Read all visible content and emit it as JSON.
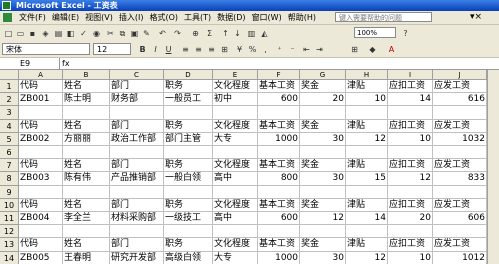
{
  "window": {
    "title": "Microsoft Excel - 工资表"
  },
  "menu": {
    "items": [
      "文件(F)",
      "编辑(E)",
      "视图(V)",
      "插入(I)",
      "格式(O)",
      "工具(T)",
      "数据(D)",
      "窗口(W)",
      "帮助(H)"
    ],
    "help_placeholder": "键入需要帮助的问题"
  },
  "toolbar": {
    "zoom": "100%",
    "font_name": "宋体",
    "font_size": "12"
  },
  "formula_bar": {
    "name_box": "E9",
    "fx": "fx",
    "value": ""
  },
  "sheet": {
    "columns": [
      "A",
      "B",
      "C",
      "D",
      "E",
      "F",
      "G",
      "H",
      "I",
      "J"
    ],
    "rows": [
      {
        "num": "1",
        "cells": [
          "代码",
          "姓名",
          "部门",
          "职务",
          "文化程度",
          "基本工资",
          "奖金",
          "津贴",
          "应扣工资",
          "应发工资"
        ]
      },
      {
        "num": "2",
        "cells": [
          "ZB001",
          "陈士明",
          "财务部",
          "一般员工",
          "初中",
          "600",
          "20",
          "10",
          "14",
          "616"
        ]
      },
      {
        "num": "3",
        "cells": [
          "",
          "",
          "",
          "",
          "",
          "",
          "",
          "",
          "",
          ""
        ]
      },
      {
        "num": "4",
        "cells": [
          "代码",
          "姓名",
          "部门",
          "职务",
          "文化程度",
          "基本工资",
          "奖金",
          "津贴",
          "应扣工资",
          "应发工资"
        ]
      },
      {
        "num": "5",
        "cells": [
          "ZB002",
          "方丽丽",
          "政治工作部",
          "部门主管",
          "大专",
          "1000",
          "30",
          "12",
          "10",
          "1032"
        ]
      },
      {
        "num": "6",
        "cells": [
          "",
          "",
          "",
          "",
          "",
          "",
          "",
          "",
          "",
          ""
        ]
      },
      {
        "num": "7",
        "cells": [
          "代码",
          "姓名",
          "部门",
          "职务",
          "文化程度",
          "基本工资",
          "奖金",
          "津贴",
          "应扣工资",
          "应发工资"
        ]
      },
      {
        "num": "8",
        "cells": [
          "ZB003",
          "陈有伟",
          "产品推销部",
          "一般白领",
          "高中",
          "800",
          "30",
          "15",
          "12",
          "833"
        ]
      },
      {
        "num": "9",
        "cells": [
          "",
          "",
          "",
          "",
          "",
          "",
          "",
          "",
          "",
          ""
        ]
      },
      {
        "num": "10",
        "cells": [
          "代码",
          "姓名",
          "部门",
          "职务",
          "文化程度",
          "基本工资",
          "奖金",
          "津贴",
          "应扣工资",
          "应发工资"
        ]
      },
      {
        "num": "11",
        "cells": [
          "ZB004",
          "李全兰",
          "材料采购部",
          "一级技工",
          "高中",
          "600",
          "12",
          "14",
          "20",
          "606"
        ]
      },
      {
        "num": "12",
        "cells": [
          "",
          "",
          "",
          "",
          "",
          "",
          "",
          "",
          "",
          ""
        ]
      },
      {
        "num": "13",
        "cells": [
          "代码",
          "姓名",
          "部门",
          "职务",
          "文化程度",
          "基本工资",
          "奖金",
          "津贴",
          "应扣工资",
          "应发工资"
        ]
      },
      {
        "num": "14",
        "cells": [
          "ZB005",
          "王春明",
          "研究开发部",
          "高级白领",
          "大专",
          "1000",
          "30",
          "12",
          "10",
          "1012"
        ]
      }
    ]
  }
}
